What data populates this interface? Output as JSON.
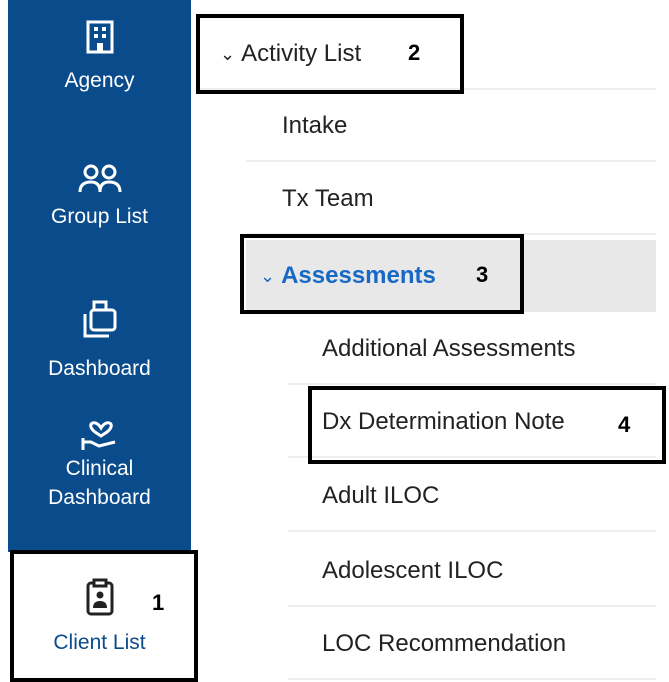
{
  "sidebar": {
    "items": [
      {
        "label": "Agency",
        "icon": "building-icon"
      },
      {
        "label": "Group List",
        "icon": "group-icon"
      },
      {
        "label": "Dashboard",
        "icon": "dashboard-icon"
      },
      {
        "label": "Clinical\nDashboard",
        "label_line1": "Clinical",
        "label_line2": "Dashboard",
        "icon": "hand-heart-icon"
      },
      {
        "label": "Client List",
        "icon": "clipboard-user-icon",
        "active": true
      }
    ]
  },
  "tree": {
    "activity_list": "Activity List",
    "children": [
      "Intake",
      "Tx Team"
    ],
    "assessments": "Assessments",
    "assessment_items": [
      "Additional Assessments",
      "Dx Determination Note",
      "Adult ILOC",
      "Adolescent ILOC",
      "LOC Recommendation"
    ]
  },
  "callouts": [
    "1",
    "2",
    "3",
    "4"
  ],
  "colors": {
    "sidebar": "#0a4b8c",
    "accent": "#1769c6",
    "highlight": "#e8e8e8"
  }
}
